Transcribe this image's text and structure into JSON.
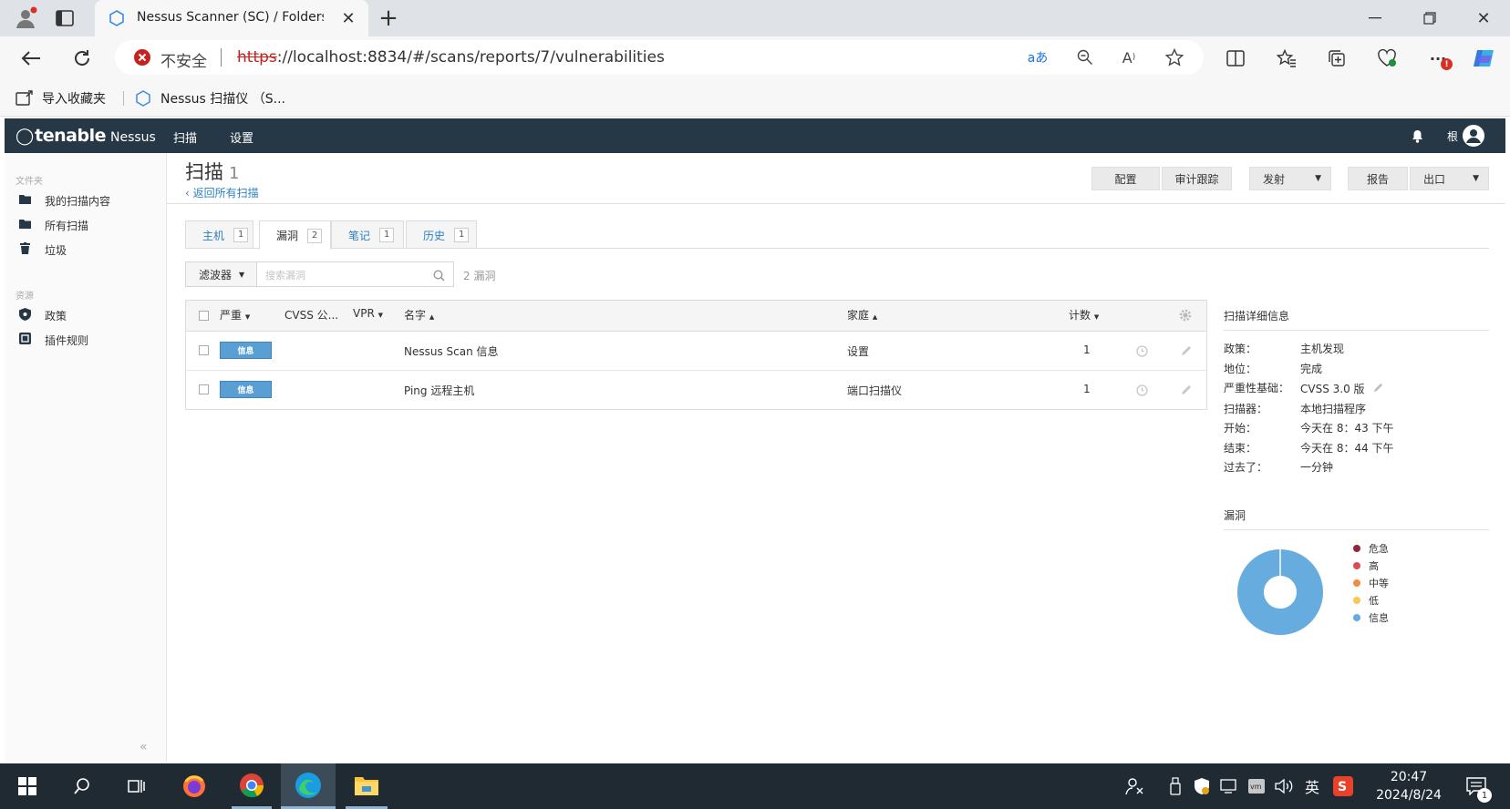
{
  "browser": {
    "tab_title": "Nessus Scanner (SC) / Folders / V",
    "security_label": "不安全",
    "url_scheme": "https",
    "url_rest": "://localhost:8834/#/scans/reports/7/vulnerabilities",
    "favorites": [
      {
        "label": "导入收藏夹"
      },
      {
        "label": "Nessus 扫描仪 （S..."
      }
    ]
  },
  "app": {
    "logo_brand": "tenable",
    "logo_product": "Nessus",
    "nav": [
      "扫描",
      "设置"
    ],
    "user_label": "根"
  },
  "sidebar": {
    "folders_heading": "文件夹",
    "folders": [
      "我的扫描内容",
      "所有扫描",
      "垃圾"
    ],
    "resources_heading": "资源",
    "resources": [
      "政策",
      "插件规则"
    ],
    "collapse": "«"
  },
  "page": {
    "title": "扫描",
    "title_count": "1",
    "back_link": "‹ 返回所有扫描",
    "buttons": {
      "configure": "配置",
      "audit": "审计跟踪",
      "launch": "发射",
      "report": "报告",
      "export": "出口"
    }
  },
  "tabs": [
    {
      "label": "主机",
      "count": "1"
    },
    {
      "label": "漏洞",
      "count": "2"
    },
    {
      "label": "笔记",
      "count": "1"
    },
    {
      "label": "历史",
      "count": "1"
    }
  ],
  "filter": {
    "label": "滤波器",
    "search_placeholder": "搜索漏洞",
    "result_count": "2 漏洞"
  },
  "table": {
    "headers": {
      "severity": "严重",
      "cvss": "CVSS 公...",
      "vpr": "VPR",
      "name": "名字",
      "family": "家庭",
      "count": "计数"
    },
    "rows": [
      {
        "severity": "信息",
        "name": "Nessus Scan 信息",
        "family": "设置",
        "count": "1"
      },
      {
        "severity": "信息",
        "name": "Ping 远程主机",
        "family": "端口扫描仪",
        "count": "1"
      }
    ]
  },
  "details": {
    "heading": "扫描详细信息",
    "fields": [
      {
        "key": "政策：",
        "value": "主机发现"
      },
      {
        "key": "地位：",
        "value": "完成"
      },
      {
        "key": "严重性基础：",
        "value": "CVSS 3.0 版"
      },
      {
        "key": "扫描器：",
        "value": "本地扫描程序"
      },
      {
        "key": "开始：",
        "value": "今天在 8：43 下午"
      },
      {
        "key": "结束：",
        "value": "今天在 8：44 下午"
      },
      {
        "key": "过去了：",
        "value": "一分钟"
      }
    ]
  },
  "vulns": {
    "heading": "漏洞",
    "legend": [
      {
        "label": "危急",
        "color": "#91243e"
      },
      {
        "label": "高",
        "color": "#dd4b50"
      },
      {
        "label": "中等",
        "color": "#f18c43"
      },
      {
        "label": "低",
        "color": "#f8c851"
      },
      {
        "label": "信息",
        "color": "#67acdf"
      }
    ]
  },
  "chart_data": {
    "type": "pie",
    "categories": [
      "危急",
      "高",
      "中等",
      "低",
      "信息"
    ],
    "values": [
      0,
      0,
      0,
      0,
      2
    ]
  },
  "taskbar": {
    "time": "20:47",
    "date": "2024/8/24",
    "ime": "英",
    "notification_count": "1"
  }
}
